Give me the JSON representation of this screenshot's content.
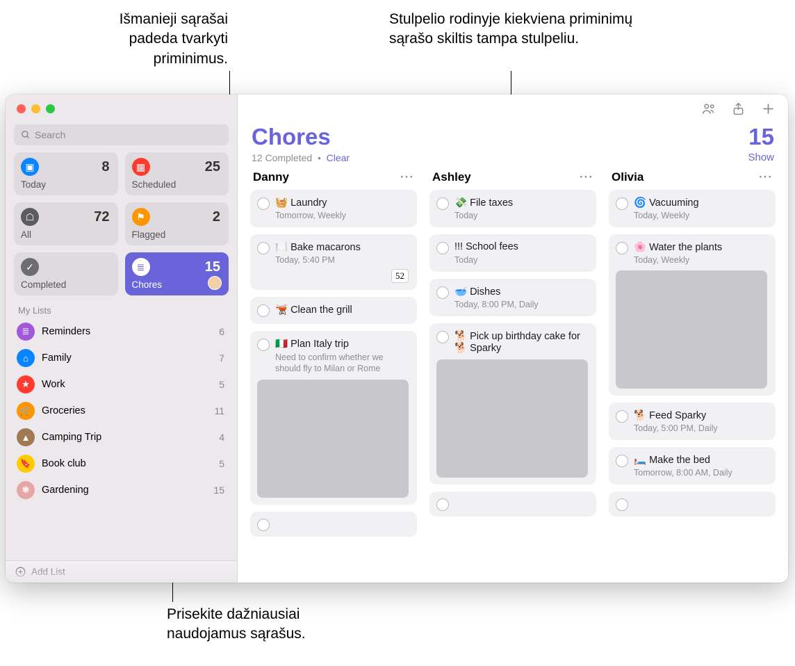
{
  "callouts": {
    "topLeft": "Išmanieji sąrašai padeda tvarkyti priminimus.",
    "topRight": "Stulpelio rodinyje kiekviena priminimų sąrašo skiltis tampa stulpeliu.",
    "bottom": "Prisekite dažniausiai naudojamus sąrašus."
  },
  "search": {
    "placeholder": "Search"
  },
  "smart": {
    "today": {
      "label": "Today",
      "count": "8"
    },
    "scheduled": {
      "label": "Scheduled",
      "count": "25"
    },
    "all": {
      "label": "All",
      "count": "72"
    },
    "flagged": {
      "label": "Flagged",
      "count": "2"
    },
    "completed": {
      "label": "Completed",
      "count": ""
    },
    "chores": {
      "label": "Chores",
      "count": "15"
    }
  },
  "myListsLabel": "My Lists",
  "lists": [
    {
      "name": "Reminders",
      "count": "6",
      "color": "#a259d9",
      "icon": "list"
    },
    {
      "name": "Family",
      "count": "7",
      "color": "#0a84ff",
      "icon": "home"
    },
    {
      "name": "Work",
      "count": "5",
      "color": "#ff3b30",
      "icon": "star"
    },
    {
      "name": "Groceries",
      "count": "11",
      "color": "#ff9500",
      "icon": "cart"
    },
    {
      "name": "Camping Trip",
      "count": "4",
      "color": "#a07a52",
      "icon": "tent"
    },
    {
      "name": "Book club",
      "count": "5",
      "color": "#ffcc00",
      "icon": "bookmark"
    },
    {
      "name": "Gardening",
      "count": "15",
      "color": "#e7a6a6",
      "icon": "leaf"
    }
  ],
  "addList": "Add List",
  "header": {
    "title": "Chores",
    "count": "15",
    "completed": "12 Completed",
    "clear": "Clear",
    "show": "Show",
    "dot": "•"
  },
  "columns": [
    {
      "name": "Danny",
      "cards": [
        {
          "emoji": "🧺",
          "title": "Laundry",
          "meta": "Tomorrow, Weekly"
        },
        {
          "emoji": "🍽️",
          "title": "Bake macarons",
          "meta": "Today, 5:40 PM",
          "badge": "52"
        },
        {
          "emoji": "🫕",
          "title": "Clean the grill"
        },
        {
          "emoji": "🇮🇹",
          "title": "Plan Italy trip",
          "note": "Need to confirm whether we should fly to Milan or Rome",
          "photo": "italy"
        }
      ],
      "trailingEmpty": true
    },
    {
      "name": "Ashley",
      "cards": [
        {
          "emoji": "💸",
          "title": "File taxes",
          "meta": "Today"
        },
        {
          "emoji": "",
          "title": "!!! School fees",
          "meta": "Today"
        },
        {
          "emoji": "🥣",
          "title": "Dishes",
          "meta": "Today, 8:00 PM, Daily"
        },
        {
          "emoji": "🐕",
          "title": "Pick up birthday cake for 🐕 Sparky",
          "wrapTitle": true,
          "photo": "dog"
        }
      ],
      "trailingEmpty": true
    },
    {
      "name": "Olivia",
      "cards": [
        {
          "emoji": "🌀",
          "title": "Vacuuming",
          "meta": "Today, Weekly"
        },
        {
          "emoji": "🌸",
          "title": "Water the plants",
          "meta": "Today, Weekly",
          "photo": "flowers"
        },
        {
          "emoji": "🐕",
          "title": "Feed Sparky",
          "meta": "Today, 5:00 PM, Daily"
        },
        {
          "emoji": "🛏️",
          "title": "Make the bed",
          "meta": "Tomorrow, 8:00 AM, Daily"
        }
      ],
      "trailingEmpty": true
    }
  ]
}
